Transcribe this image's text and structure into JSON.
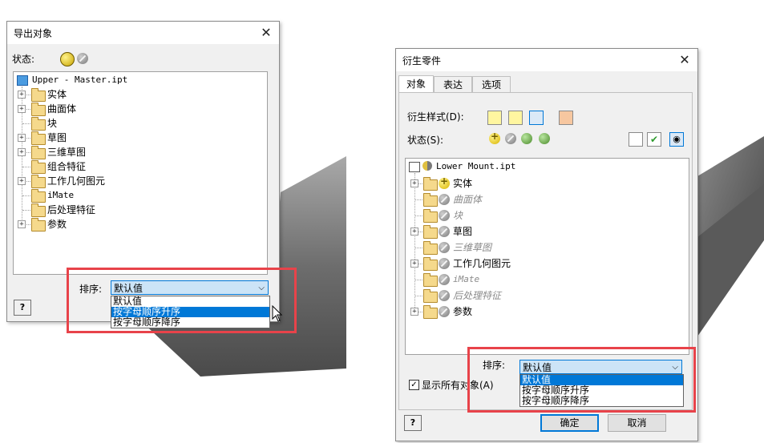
{
  "left_dialog": {
    "title": "导出对象",
    "state_label": "状态:",
    "tree": {
      "root": "Upper - Master.ipt",
      "items": [
        {
          "label": "实体",
          "expandable": true,
          "mono": false
        },
        {
          "label": "曲面体",
          "expandable": true,
          "mono": false
        },
        {
          "label": "块",
          "expandable": false,
          "mono": false
        },
        {
          "label": "草图",
          "expandable": true,
          "mono": false
        },
        {
          "label": "三维草图",
          "expandable": true,
          "mono": false
        },
        {
          "label": "组合特征",
          "expandable": false,
          "mono": false
        },
        {
          "label": "工作几何图元",
          "expandable": true,
          "mono": false
        },
        {
          "label": "iMate",
          "expandable": false,
          "mono": true
        },
        {
          "label": "后处理特征",
          "expandable": false,
          "mono": false
        },
        {
          "label": "参数",
          "expandable": true,
          "mono": false
        }
      ]
    },
    "sort_label": "排序:",
    "sort_value": "默认值",
    "sort_options": [
      "默认值",
      "按字母顺序升序",
      "按字母顺序降序"
    ],
    "sort_highlighted_index": 1,
    "help_label": "?"
  },
  "right_dialog": {
    "title": "衍生零件",
    "tabs": [
      "对象",
      "表达",
      "选项"
    ],
    "derive_style_label": "衍生样式(D):",
    "state_label": "状态(S):",
    "tree": {
      "root": "Lower Mount.ipt",
      "items": [
        {
          "label": "实体",
          "expandable": true,
          "excluded": false,
          "icon": "include"
        },
        {
          "label": "曲面体",
          "expandable": false,
          "excluded": true,
          "icon": "exclude"
        },
        {
          "label": "块",
          "expandable": false,
          "excluded": true,
          "icon": "exclude"
        },
        {
          "label": "草图",
          "expandable": true,
          "excluded": false,
          "icon": "exclude"
        },
        {
          "label": "三维草图",
          "expandable": false,
          "excluded": true,
          "icon": "exclude"
        },
        {
          "label": "工作几何图元",
          "expandable": true,
          "excluded": false,
          "icon": "exclude"
        },
        {
          "label": "iMate",
          "expandable": false,
          "excluded": true,
          "icon": "exclude",
          "mono": true
        },
        {
          "label": "后处理特征",
          "expandable": false,
          "excluded": true,
          "icon": "exclude"
        },
        {
          "label": "参数",
          "expandable": true,
          "excluded": false,
          "icon": "exclude"
        }
      ]
    },
    "sort_label": "排序:",
    "sort_value": "默认值",
    "sort_options": [
      "默认值",
      "按字母顺序升序",
      "按字母顺序降序"
    ],
    "sort_highlighted_index": 0,
    "show_all_label": "显示所有对象(A)",
    "show_all_checked": true,
    "ok_label": "确定",
    "cancel_label": "取消",
    "help_label": "?"
  },
  "colors": {
    "highlight": "#e8434a",
    "selection": "#0078d7",
    "folder": "#f5d98c"
  }
}
